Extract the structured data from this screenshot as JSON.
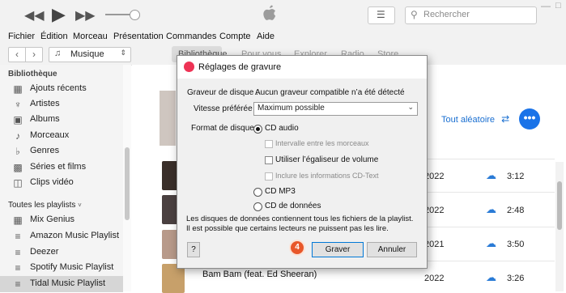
{
  "player": {
    "search_placeholder": "Rechercher"
  },
  "menu": [
    "Fichier",
    "Édition",
    "Morceau",
    "Présentation",
    "Commandes",
    "Compte",
    "Aide"
  ],
  "nav": {
    "library_select": "Musique",
    "tabs": [
      "Bibliothèque",
      "Pour vous",
      "Explorer",
      "Radio",
      "Store"
    ]
  },
  "sidebar": {
    "library_header": "Bibliothèque",
    "library_items": [
      {
        "label": "Ajouts récents",
        "icon": "grid-icon"
      },
      {
        "label": "Artistes",
        "icon": "microphone-icon"
      },
      {
        "label": "Albums",
        "icon": "album-icon"
      },
      {
        "label": "Morceaux",
        "icon": "note-icon"
      },
      {
        "label": "Genres",
        "icon": "genres-icon"
      },
      {
        "label": "Séries et films",
        "icon": "film-icon"
      },
      {
        "label": "Clips vidéo",
        "icon": "video-icon"
      }
    ],
    "playlists_header": "Toutes les playlists",
    "playlists": [
      {
        "label": "Mix Genius",
        "icon": "genius-icon"
      },
      {
        "label": "Amazon Music Playlist",
        "icon": "playlist-icon"
      },
      {
        "label": "Deezer",
        "icon": "playlist-icon"
      },
      {
        "label": "Spotify Music Playlist",
        "icon": "playlist-icon"
      },
      {
        "label": "Tidal Music Playlist",
        "icon": "playlist-icon"
      }
    ]
  },
  "main": {
    "shuffle_label": "Tout aléatoire",
    "tracks": [
      {
        "year": "2022",
        "duration": "3:12"
      },
      {
        "year": "2022",
        "duration": "2:48"
      },
      {
        "year": "2021",
        "duration": "3:50"
      },
      {
        "title": "Bam Bam (feat. Ed Sheeran)",
        "year": "2022",
        "duration": "3:26"
      }
    ]
  },
  "dialog": {
    "title": "Réglages de gravure",
    "burner_label": "Graveur de disque :",
    "burner_value": "Aucun graveur compatible n’a été détecté",
    "speed_label": "Vitesse préférée :",
    "speed_value": "Maximum possible",
    "format_label": "Format de disque :",
    "opt_cd_audio": "CD audio",
    "opt_gap": "Intervalle entre les morceaux",
    "opt_eq": "Utiliser l’égaliseur de volume",
    "opt_cdtext": "Inclure les informations CD-Text",
    "opt_mp3": "CD MP3",
    "opt_data": "CD de données",
    "info": "Les disques de données contiennent tous les fichiers de la playlist. Il est possible que certains lecteurs ne puissent pas les lire.",
    "help_label": "?",
    "burn_label": "Graver",
    "cancel_label": "Annuler",
    "step_badge": "4"
  }
}
